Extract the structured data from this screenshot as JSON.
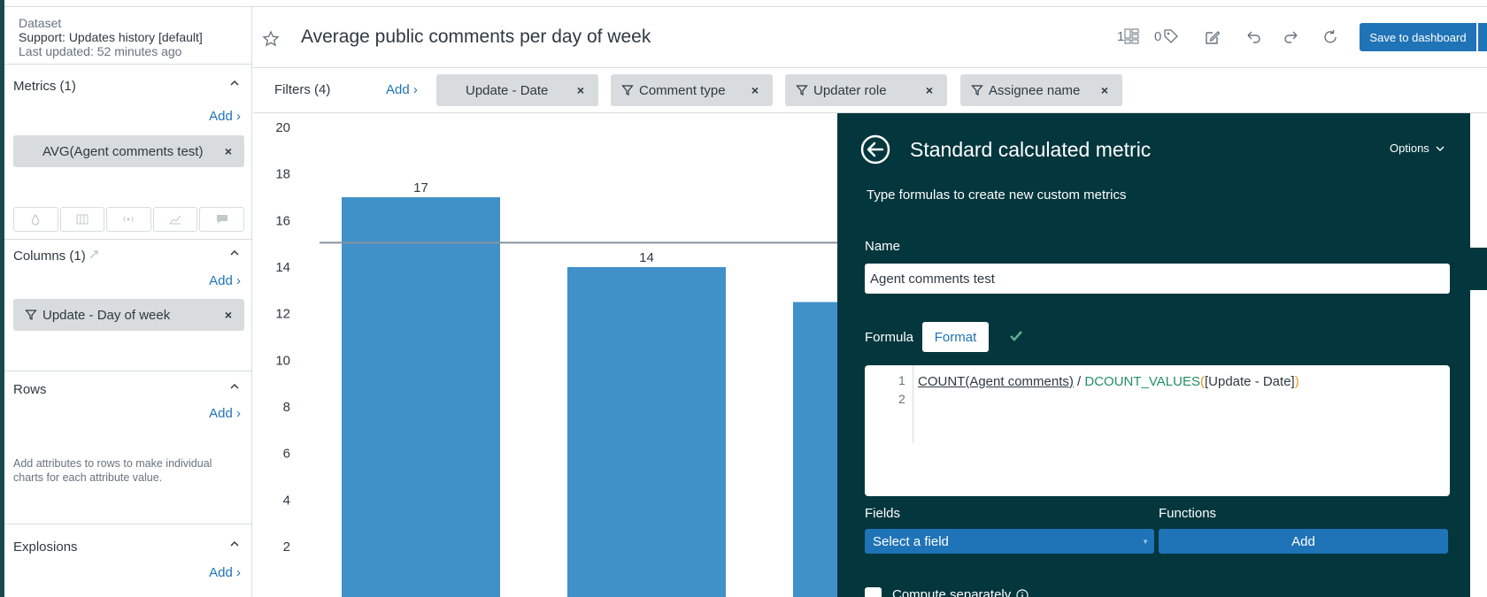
{
  "dataset": {
    "label": "Dataset",
    "name": "Support: Updates history [default]",
    "last_updated": "Last updated: 52 minutes ago"
  },
  "sidebar": {
    "metrics": {
      "title": "Metrics (1)",
      "add": "Add ›",
      "pill": "AVG(Agent comments test)"
    },
    "columns": {
      "title": "Columns (1)",
      "add": "Add ›",
      "pill": "Update - Day of week"
    },
    "rows": {
      "title": "Rows",
      "add": "Add ›",
      "hint": "Add attributes to rows to make individual charts for each attribute value."
    },
    "explosions": {
      "title": "Explosions",
      "add": "Add ›"
    }
  },
  "header": {
    "title": "Average public comments per day of week",
    "count_widgets": "1",
    "count_tags": "0",
    "save_label": "Save to dashboard"
  },
  "filters": {
    "label": "Filters (4)",
    "add": "Add ›",
    "chips": [
      "Update - Date",
      "Comment type",
      "Updater role",
      "Assignee name"
    ]
  },
  "chart_data": {
    "type": "bar",
    "categories": [
      "",
      "",
      ""
    ],
    "values": [
      17,
      14,
      12.5
    ],
    "data_labels": [
      "17",
      "14",
      ""
    ],
    "y_ticks": [
      "2",
      "4",
      "6",
      "8",
      "10",
      "12",
      "14",
      "16",
      "18",
      "20"
    ],
    "ylim": [
      0,
      20
    ],
    "reference_line": 15.05,
    "bar_color": "#4191c9"
  },
  "panel": {
    "title": "Standard calculated metric",
    "options": "Options",
    "subtitle": "Type formulas to create new custom metrics",
    "name_label": "Name",
    "name_value": "Agent comments test",
    "formula_label": "Formula",
    "format_button": "Format",
    "line_numbers": [
      "1",
      "2"
    ],
    "formula": {
      "part1": "COUNT(Agent comments)",
      "op": " / ",
      "fn": "DCOUNT_VALUES",
      "open": "(",
      "arg": "[Update - Date]",
      "close": ")"
    },
    "fields_label": "Fields",
    "functions_label": "Functions",
    "select_field": "Select a field",
    "add_function": "Add",
    "compute_separately": "Compute separately"
  }
}
